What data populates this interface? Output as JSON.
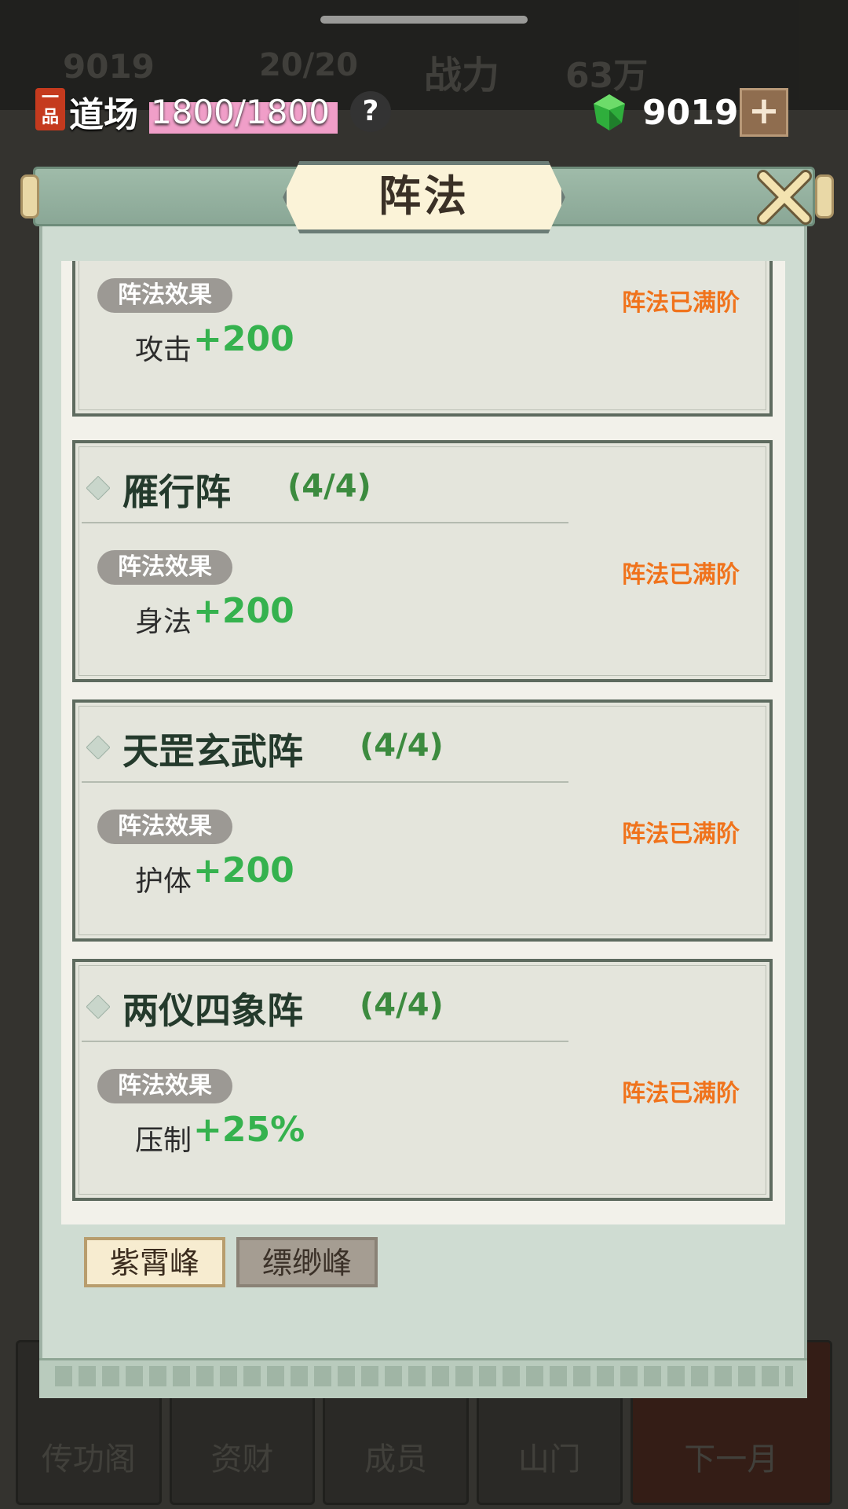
{
  "background": {
    "ghost_texts": [
      "9019",
      "20/20",
      "战力",
      "63万"
    ],
    "bottom_tabs": [
      "传功阁",
      "资财",
      "成员",
      "山门",
      "下一月"
    ]
  },
  "hud": {
    "rank_badge": "一品",
    "dojo_label": "道场",
    "dojo_value": "1800/1800",
    "help": "?",
    "gems": "9019",
    "plus": "+"
  },
  "panel": {
    "title": "阵法",
    "cards": [
      {
        "name": "",
        "progress": "",
        "effect_label": "阵法效果",
        "stat": "攻击",
        "value": "+200",
        "status": "阵法已满阶"
      },
      {
        "name": "雁行阵",
        "progress": "(4/4)",
        "effect_label": "阵法效果",
        "stat": "身法",
        "value": "+200",
        "status": "阵法已满阶"
      },
      {
        "name": "天罡玄武阵",
        "progress": "(4/4)",
        "effect_label": "阵法效果",
        "stat": "护体",
        "value": "+200",
        "status": "阵法已满阶"
      },
      {
        "name": "两仪四象阵",
        "progress": "(4/4)",
        "effect_label": "阵法效果",
        "stat": "压制",
        "value": "+25%",
        "status": "阵法已满阶"
      }
    ],
    "tabs": [
      {
        "label": "紫霄峰",
        "active": true
      },
      {
        "label": "缥缈峰",
        "active": false
      }
    ]
  },
  "colors": {
    "accent_orange": "#f0731c",
    "stat_green": "#35b24e",
    "progress_green": "#3c8b3f"
  }
}
